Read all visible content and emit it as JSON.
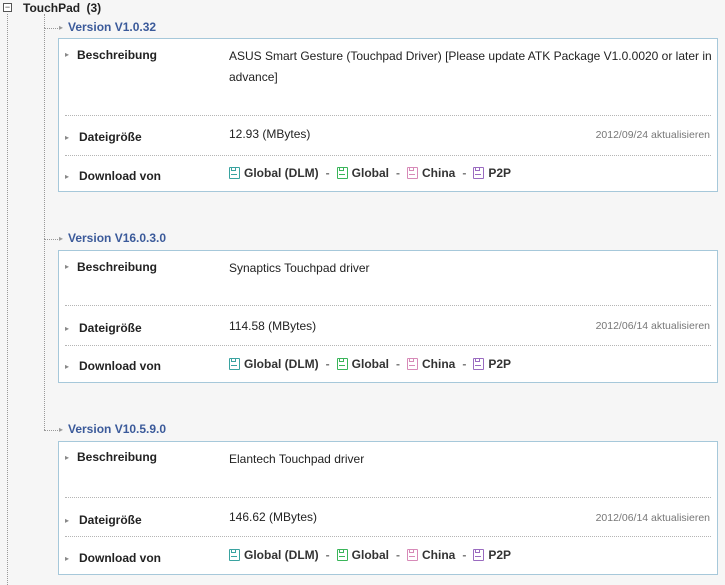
{
  "group": {
    "title": "TouchPad",
    "count": "(3)",
    "toggle": "−"
  },
  "labels": {
    "description": "Beschreibung",
    "filesize": "Dateigröße",
    "download": "Download von"
  },
  "links": {
    "sep": "-",
    "global_dlm": "Global (DLM)",
    "global": "Global",
    "china": "China",
    "p2p": "P2P"
  },
  "colors": {
    "version_title": "#3b5a9a",
    "panel_border": "#a6c8da",
    "global_dlm": "#3aa3a0",
    "global": "#3ab55a",
    "china": "#d78ab8",
    "p2p": "#9a6bc0"
  },
  "versions": [
    {
      "title": "Version V1.0.32",
      "description": "ASUS Smart Gesture (Touchpad Driver)  [Please update ATK Package V1.0.0020 or later in advance]",
      "size": "12.93 (MBytes)",
      "date": "2012/09/24 aktualisieren"
    },
    {
      "title": "Version V16.0.3.0",
      "description": "Synaptics Touchpad driver",
      "size": "114.58 (MBytes)",
      "date": "2012/06/14 aktualisieren"
    },
    {
      "title": "Version V10.5.9.0",
      "description": "Elantech Touchpad driver",
      "size": "146.62 (MBytes)",
      "date": "2012/06/14 aktualisieren"
    }
  ]
}
